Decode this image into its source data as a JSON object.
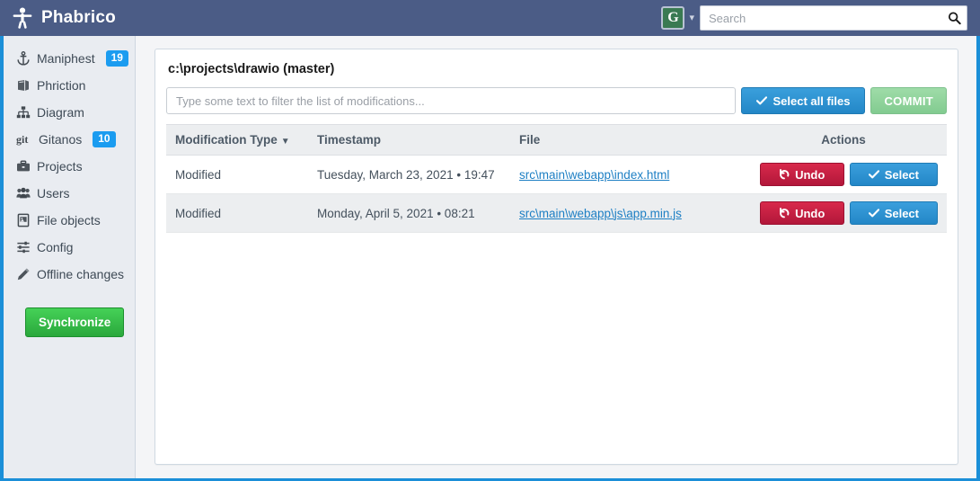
{
  "header": {
    "brand_title": "Phabrico",
    "brand_icon": "person-icon",
    "user_initial": "G",
    "caret_icon": "chevron-down-icon",
    "search_placeholder": "Search",
    "search_value": "",
    "search_icon": "search-icon"
  },
  "sidebar": {
    "items": [
      {
        "label": "Maniphest",
        "icon": "anchor-icon",
        "badge": "19"
      },
      {
        "label": "Phriction",
        "icon": "book-icon",
        "badge": ""
      },
      {
        "label": "Diagram",
        "icon": "sitemap-icon",
        "badge": ""
      },
      {
        "label": "Gitanos",
        "icon": "git-icon",
        "badge": "10"
      },
      {
        "label": "Projects",
        "icon": "briefcase-icon",
        "badge": ""
      },
      {
        "label": "Users",
        "icon": "users-icon",
        "badge": ""
      },
      {
        "label": "File objects",
        "icon": "file-image-icon",
        "badge": ""
      },
      {
        "label": "Config",
        "icon": "sliders-icon",
        "badge": ""
      },
      {
        "label": "Offline changes",
        "icon": "pencil-icon",
        "badge": ""
      }
    ],
    "sync_button": "Synchronize"
  },
  "main": {
    "panel_title": "c:\\projects\\drawio (master)",
    "filter_placeholder": "Type some text to filter the list of modifications...",
    "filter_value": "",
    "select_all_label": "Select all files",
    "select_all_icon": "check-icon",
    "commit_label": "COMMIT",
    "table": {
      "headers": {
        "modification_type": "Modification Type",
        "sort_caret": "▼",
        "timestamp": "Timestamp",
        "file": "File",
        "actions": "Actions"
      },
      "rows": [
        {
          "modification_type": "Modified",
          "timestamp": "Tuesday, March 23, 2021 • 19:47",
          "file": "src\\main\\webapp\\index.html",
          "undo_label": "Undo",
          "select_label": "Select"
        },
        {
          "modification_type": "Modified",
          "timestamp": "Monday, April 5, 2021 • 08:21",
          "file": "src\\main\\webapp\\js\\app.min.js",
          "undo_label": "Undo",
          "select_label": "Select"
        }
      ]
    }
  },
  "colors": {
    "header_bg": "#4b5c86",
    "accent_blue": "#1b8fd8",
    "badge_blue": "#1b9cf0",
    "sync_green": "#2aa83c",
    "undo_red": "#c9213e",
    "select_blue": "#2387c7",
    "commit_green": "#8fd19d",
    "link_blue": "#1d7fc4",
    "sidebar_bg": "#e9ecf1"
  }
}
